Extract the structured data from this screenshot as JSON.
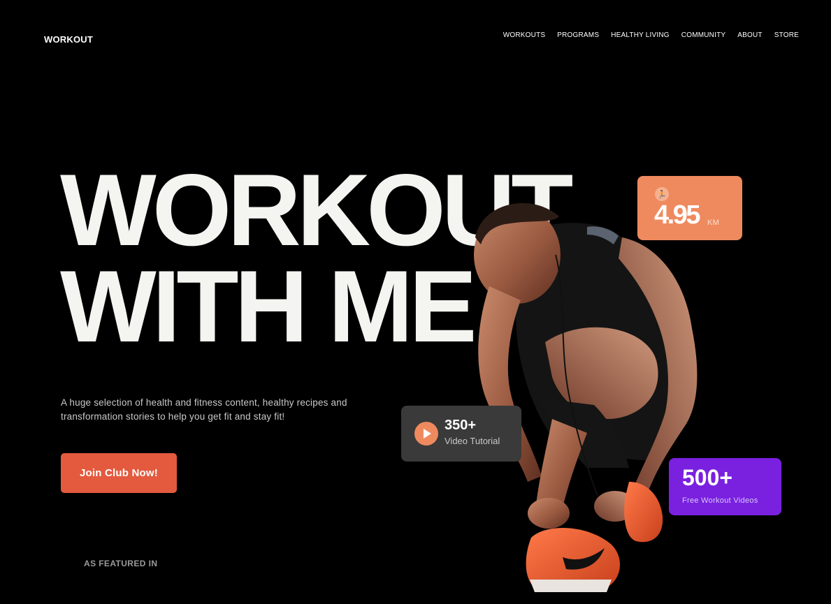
{
  "header": {
    "logo": "WORKOUT",
    "nav": [
      "WORKOUTS",
      "PROGRAMS",
      "HEALTHY LIVING",
      "COMMUNITY",
      "ABOUT",
      "STORE"
    ]
  },
  "hero": {
    "title_line1": "WORKOUT",
    "title_line2": "WITH ME",
    "description": "A huge selection of health and fitness content, healthy recipes and transformation stories to help you get fit and stay fit!",
    "cta": "Join Club Now!",
    "featured": "AS FEATURED IN"
  },
  "stats": {
    "distance": {
      "icon": "runner-icon",
      "value": "4.95",
      "unit": "KM"
    },
    "video": {
      "icon": "play-icon",
      "count": "350+",
      "label": "Video Tutorial"
    },
    "free": {
      "count": "500+",
      "label": "Free Workout Videos"
    }
  },
  "colors": {
    "background": "#000000",
    "accent_orange": "#ef8a5f",
    "button_red": "#e35a3e",
    "card_dark": "#3a3a3a",
    "card_purple": "#7a21e0"
  }
}
